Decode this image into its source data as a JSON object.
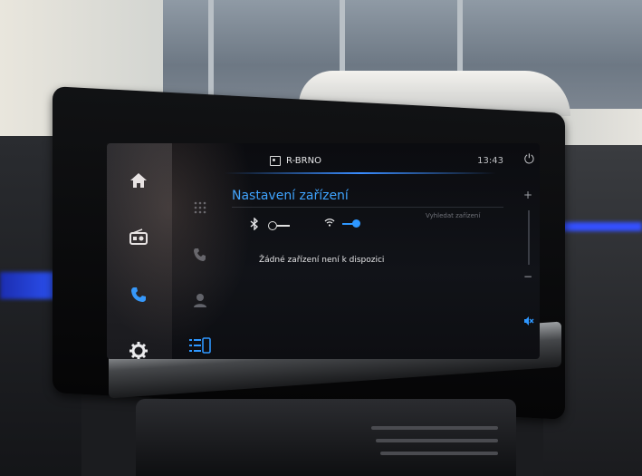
{
  "topbar": {
    "station": "R-BRNO",
    "clock": "13:43"
  },
  "left_rail": {
    "items": [
      {
        "icon": "home-icon"
      },
      {
        "icon": "radio-icon"
      },
      {
        "icon": "phone-icon",
        "active": true
      },
      {
        "icon": "gear-icon"
      }
    ]
  },
  "sub_rail": {
    "items": [
      {
        "icon": "dialpad-icon"
      },
      {
        "icon": "call-log-icon"
      },
      {
        "icon": "contacts-icon"
      },
      {
        "icon": "device-list-icon",
        "active": true
      }
    ]
  },
  "main": {
    "title": "Nastavení zařízení",
    "bluetooth_enabled": false,
    "wifi_enabled": true,
    "search_label": "Vyhledat zařízení",
    "empty_message": "Žádné zařízení není k dispozici"
  },
  "right_rail": {
    "items": [
      {
        "icon": "volume-up-icon"
      },
      {
        "icon": "volume-down-icon"
      },
      {
        "icon": "mute-icon"
      }
    ]
  },
  "colors": {
    "accent": "#2e97ff",
    "title": "#3fa4ff"
  }
}
